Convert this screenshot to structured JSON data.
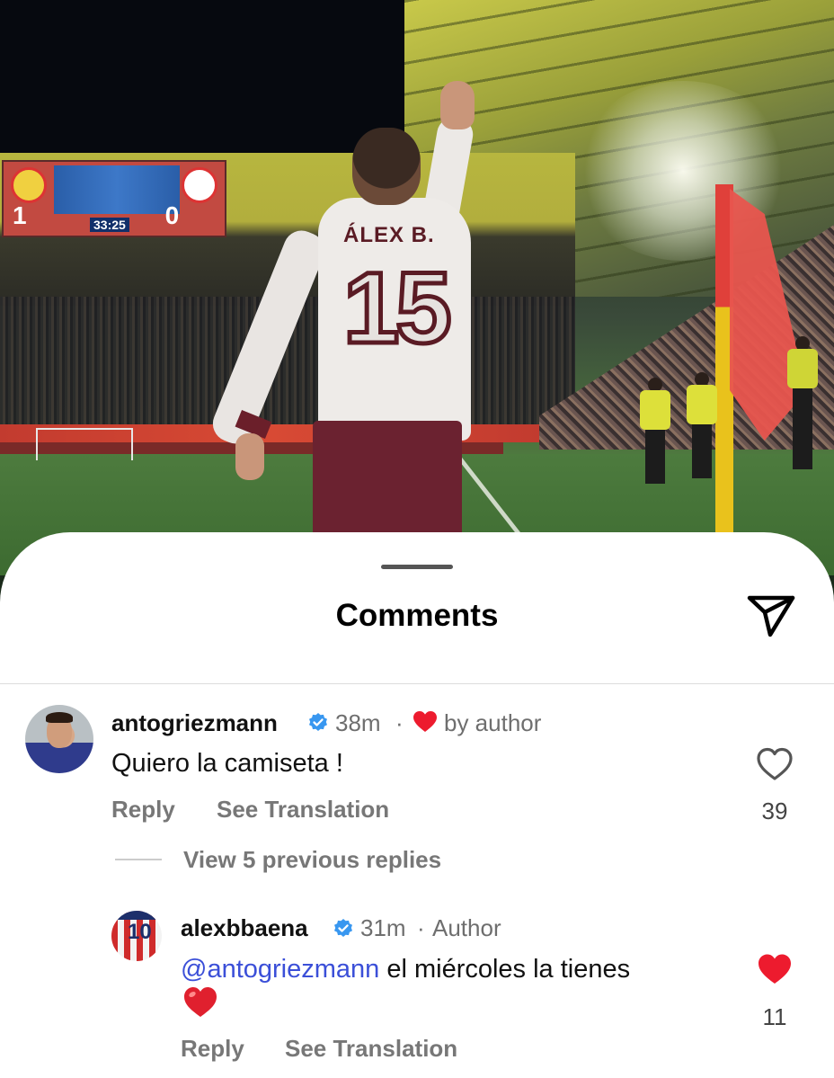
{
  "post_image": {
    "jersey_name": "ÁLEX B.",
    "jersey_number": "15",
    "scoreboard_score_left": "1",
    "scoreboard_score_right": "0",
    "scoreboard_clock": "33:25"
  },
  "sheet": {
    "title": "Comments",
    "share_icon": "paper-plane-icon"
  },
  "comments": [
    {
      "username": "antogriezmann",
      "verified": true,
      "time": "38m",
      "separator": "·",
      "liked_by_author_label": "by author",
      "text": "Quiero la camiseta !",
      "reply_label": "Reply",
      "translate_label": "See Translation",
      "like_count": "39",
      "liked": false
    }
  ],
  "view_replies_label": "View 5 previous replies",
  "replies": [
    {
      "username": "alexbbaena",
      "verified": true,
      "time": "31m",
      "separator": "·",
      "role_label": "Author",
      "mention": "@antogriezmann",
      "text": "el miércoles la tienes",
      "emoji": "red-heart-emoji",
      "reply_label": "Reply",
      "translate_label": "See Translation",
      "like_count": "11",
      "liked": true
    }
  ],
  "colors": {
    "mention": "#3b4fd8",
    "verified": "#3897f0",
    "like_red": "#ed1b2e",
    "muted_text": "#6e6e6e"
  }
}
